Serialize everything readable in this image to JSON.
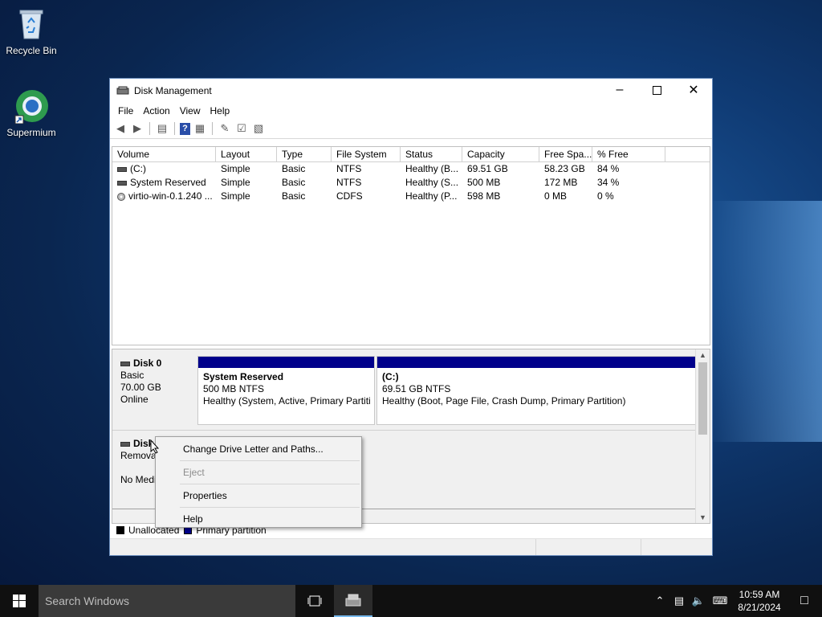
{
  "desktop": {
    "icons": [
      {
        "label": "Recycle Bin"
      },
      {
        "label": "Supermium"
      }
    ]
  },
  "window": {
    "title": "Disk Management",
    "menu": [
      "File",
      "Action",
      "View",
      "Help"
    ],
    "columns": [
      "Volume",
      "Layout",
      "Type",
      "File System",
      "Status",
      "Capacity",
      "Free Spa...",
      "% Free"
    ],
    "volumes": [
      {
        "volume": "(C:)",
        "layout": "Simple",
        "type": "Basic",
        "fs": "NTFS",
        "status": "Healthy (B...",
        "capacity": "69.51 GB",
        "free": "58.23 GB",
        "pct": "84 %",
        "icon": "hard-drive-icon"
      },
      {
        "volume": "System Reserved",
        "layout": "Simple",
        "type": "Basic",
        "fs": "NTFS",
        "status": "Healthy (S...",
        "capacity": "500 MB",
        "free": "172 MB",
        "pct": "34 %",
        "icon": "hard-drive-icon"
      },
      {
        "volume": "virtio-win-0.1.240 ...",
        "layout": "Simple",
        "type": "Basic",
        "fs": "CDFS",
        "status": "Healthy (P...",
        "capacity": "598 MB",
        "free": "0 MB",
        "pct": "0 %",
        "icon": "cd-drive-icon"
      }
    ],
    "disk0": {
      "name": "Disk 0",
      "kind": "Basic",
      "size": "70.00 GB",
      "state": "Online",
      "partitions": [
        {
          "name": "System Reserved",
          "size": "500 MB NTFS",
          "status": "Healthy (System, Active, Primary Partiti"
        },
        {
          "name": "(C:)",
          "size": "69.51 GB NTFS",
          "status": "Healthy (Boot, Page File, Crash Dump, Primary Partition)"
        }
      ]
    },
    "disk1": {
      "name": "Disk",
      "kind": "Removal",
      "state": "No Medi"
    },
    "legend": [
      {
        "label": "Unallocated",
        "color": "#000000"
      },
      {
        "label": "Primary partition",
        "color": "#00008b"
      }
    ]
  },
  "context_menu": {
    "items": [
      {
        "label": "Change Drive Letter and Paths...",
        "enabled": true
      },
      {
        "label": "Eject",
        "enabled": false
      },
      {
        "label": "Properties",
        "enabled": true
      },
      {
        "label": "Help",
        "enabled": true
      }
    ]
  },
  "taskbar": {
    "search_placeholder": "Search Windows",
    "time": "10:59 AM",
    "date": "8/21/2024"
  },
  "colors": {
    "primary_partition": "#00008b",
    "accent": "#76b9ed"
  }
}
